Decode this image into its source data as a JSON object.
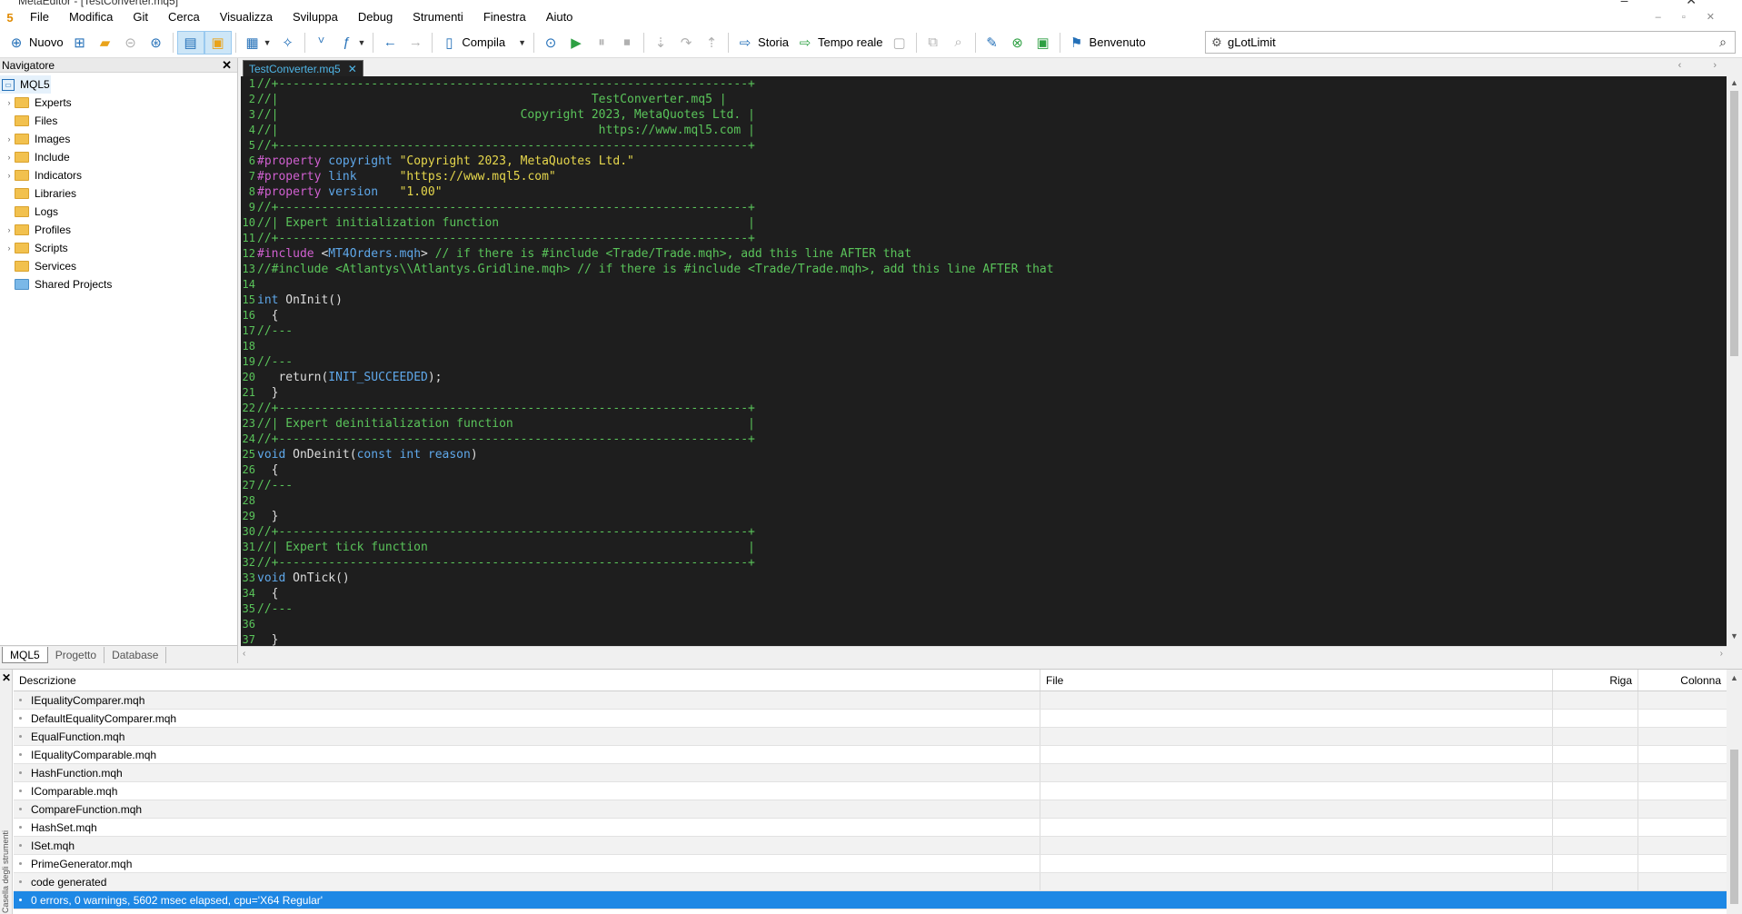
{
  "window": {
    "title": "MetaEditor - [TestConverter.mq5]"
  },
  "menu": {
    "items": [
      "File",
      "Modifica",
      "Git",
      "Cerca",
      "Visualizza",
      "Sviluppa",
      "Debug",
      "Strumenti",
      "Finestra",
      "Aiuto"
    ]
  },
  "toolbar": {
    "new_label": "Nuovo",
    "compile_label": "Compila",
    "history_label": "Storia",
    "realtime_label": "Tempo reale",
    "welcome_label": "Benvenuto",
    "search_value": "gLotLimit"
  },
  "navigator": {
    "title": "Navigatore",
    "root": "MQL5",
    "folders": [
      "Experts",
      "Files",
      "Images",
      "Include",
      "Indicators",
      "Libraries",
      "Logs",
      "Profiles",
      "Scripts",
      "Services",
      "Shared Projects"
    ],
    "tabs": [
      "MQL5",
      "Progetto",
      "Database"
    ]
  },
  "editor": {
    "tab_label": "TestConverter.mq5",
    "lines": [
      "//+------------------------------------------------------------------+",
      "//|                                            TestConverter.mq5 |",
      "//|                                  Copyright 2023, MetaQuotes Ltd. |",
      "//|                                             https://www.mql5.com |",
      "//+------------------------------------------------------------------+",
      "#property copyright \"Copyright 2023, MetaQuotes Ltd.\"",
      "#property link      \"https://www.mql5.com\"",
      "#property version   \"1.00\"",
      "//+------------------------------------------------------------------+",
      "//| Expert initialization function                                   |",
      "//+------------------------------------------------------------------+",
      "#include <MT4Orders.mqh> // if there is #include <Trade/Trade.mqh>, add this line AFTER that",
      "//#include <Atlantys\\\\Atlantys.Gridline.mqh> // if there is #include <Trade/Trade.mqh>, add this line AFTER that",
      "",
      "int OnInit()",
      "  {",
      "//---",
      "",
      "//---",
      "   return(INIT_SUCCEEDED);",
      "  }",
      "//+------------------------------------------------------------------+",
      "//| Expert deinitialization function                                 |",
      "//+------------------------------------------------------------------+",
      "void OnDeinit(const int reason)",
      "  {",
      "//---",
      "",
      "  }",
      "//+------------------------------------------------------------------+",
      "//| Expert tick function                                             |",
      "//+------------------------------------------------------------------+",
      "void OnTick()",
      "  {",
      "//---",
      "",
      "  }"
    ]
  },
  "output": {
    "columns": [
      "Descrizione",
      "File",
      "Riga",
      "Colonna"
    ],
    "rows": [
      "IEqualityComparer.mqh",
      "DefaultEqualityComparer.mqh",
      "EqualFunction.mqh",
      "IEqualityComparable.mqh",
      "HashFunction.mqh",
      "IComparable.mqh",
      "CompareFunction.mqh",
      "HashSet.mqh",
      "ISet.mqh",
      "PrimeGenerator.mqh",
      "code generated",
      "0 errors, 0 warnings, 5602 msec elapsed, cpu='X64 Regular'"
    ],
    "selected_row": 11,
    "side_label": "Casella degli strumenti"
  },
  "colors": {
    "selection": "#1e88e5",
    "editor_bg": "#1e1e1e",
    "comment": "#5ac45a",
    "string": "#e6d74c",
    "keyword": "#5fa8ea"
  }
}
